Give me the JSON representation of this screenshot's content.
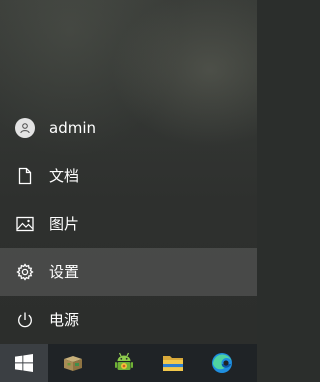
{
  "start_menu": {
    "items": [
      {
        "id": "user",
        "label": "admin",
        "icon": "user-avatar-icon"
      },
      {
        "id": "documents",
        "label": "文档",
        "icon": "document-icon"
      },
      {
        "id": "pictures",
        "label": "图片",
        "icon": "picture-icon"
      },
      {
        "id": "settings",
        "label": "设置",
        "icon": "gear-icon",
        "hovered": true
      },
      {
        "id": "power",
        "label": "电源",
        "icon": "power-icon"
      }
    ]
  },
  "taskbar": {
    "buttons": [
      {
        "id": "start",
        "icon": "windows-logo-icon",
        "active": true
      },
      {
        "id": "store",
        "icon": "store-box-icon"
      },
      {
        "id": "android",
        "icon": "android-app-icon"
      },
      {
        "id": "explorer",
        "icon": "file-explorer-icon"
      },
      {
        "id": "edge",
        "icon": "edge-browser-icon"
      }
    ]
  },
  "colors": {
    "menu_text": "#ffffff",
    "taskbar_bg": "#1f2326",
    "accent": "#78a6d6"
  }
}
